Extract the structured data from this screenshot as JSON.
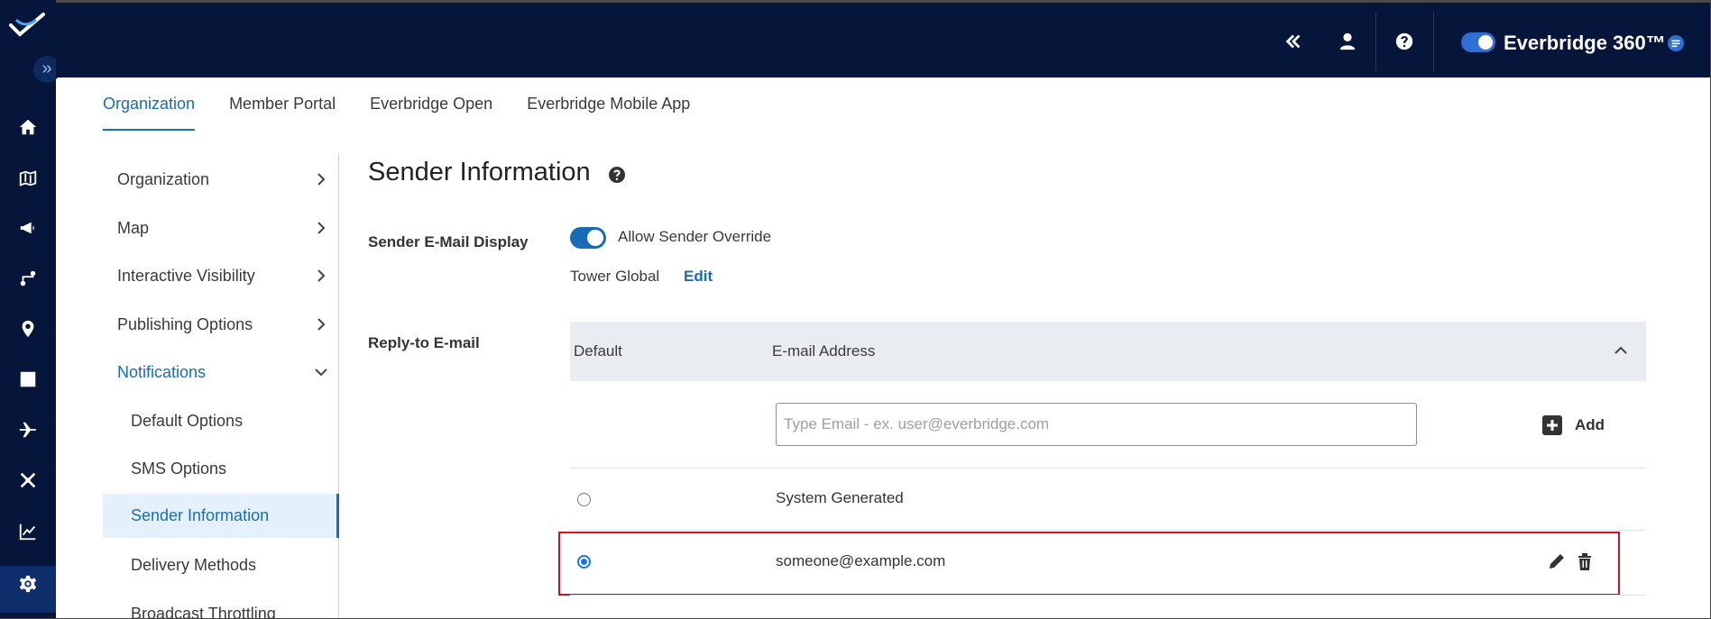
{
  "header": {
    "brand": "Everbridge 360™",
    "accent_color": "#2f6fd6",
    "icons": [
      "collapse-left-icon",
      "user-icon",
      "help-icon",
      "chat-icon"
    ]
  },
  "rail": {
    "icons": [
      "home-icon",
      "map-icon",
      "megaphone-icon",
      "route-icon",
      "location-pin-icon",
      "report-icon",
      "plane-icon",
      "incident-icon",
      "analytics-icon",
      "settings-icon"
    ]
  },
  "tabs": [
    {
      "label": "Organization",
      "active": true
    },
    {
      "label": "Member Portal"
    },
    {
      "label": "Everbridge Open"
    },
    {
      "label": "Everbridge Mobile App"
    }
  ],
  "sidenav": {
    "items": [
      {
        "label": "Organization"
      },
      {
        "label": "Map"
      },
      {
        "label": "Interactive Visibility"
      },
      {
        "label": "Publishing Options"
      },
      {
        "label": "Notifications"
      },
      {
        "label": "Default Options"
      },
      {
        "label": "SMS Options"
      },
      {
        "label": "Sender Information"
      },
      {
        "label": "Delivery Methods"
      },
      {
        "label": "Broadcast Throttling"
      }
    ]
  },
  "main": {
    "title": "Sender Information",
    "sender_email_label": "Sender E-Mail Display",
    "allow_override_label": "Allow Sender Override",
    "sender_name": "Tower Global",
    "edit_label": "Edit",
    "reply_to_label": "Reply-to E-mail",
    "table": {
      "col_default": "Default",
      "col_email": "E-mail Address",
      "input_placeholder": "Type Email - ex. user@everbridge.com",
      "add_label": "Add",
      "rows": [
        {
          "email": "System Generated",
          "default": false
        },
        {
          "email": "someone@example.com",
          "default": true
        }
      ]
    }
  }
}
